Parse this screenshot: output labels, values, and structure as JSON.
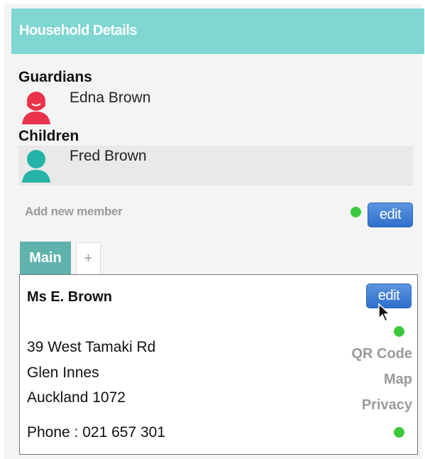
{
  "header": {
    "title": "Household Details"
  },
  "guardians": {
    "label": "Guardians",
    "members": [
      {
        "name": "Edna Brown",
        "avatar": "female-avatar-icon",
        "color": "#e8334a"
      }
    ]
  },
  "children": {
    "label": "Children",
    "members": [
      {
        "name": "Fred Brown",
        "avatar": "male-avatar-icon",
        "color": "#25b3a7"
      }
    ]
  },
  "add_member": {
    "label": "Add new member",
    "edit_label": "edit"
  },
  "tabs": [
    {
      "label": "Main",
      "active": true
    },
    {
      "label": "+",
      "active": false
    }
  ],
  "contact": {
    "name": "Ms E. Brown",
    "edit_label": "edit",
    "address_lines": [
      "39 West Tamaki Rd",
      "Glen Innes",
      "Auckland 1072"
    ],
    "phone": "Phone : 021 657 301",
    "links": [
      "QR Code",
      "Map",
      "Privacy"
    ]
  },
  "colors": {
    "header_bg": "#7fd6d2",
    "tab_active": "#5fb3ac",
    "status_dot": "#3cc83c",
    "edit_button": "#3b7bd6"
  }
}
